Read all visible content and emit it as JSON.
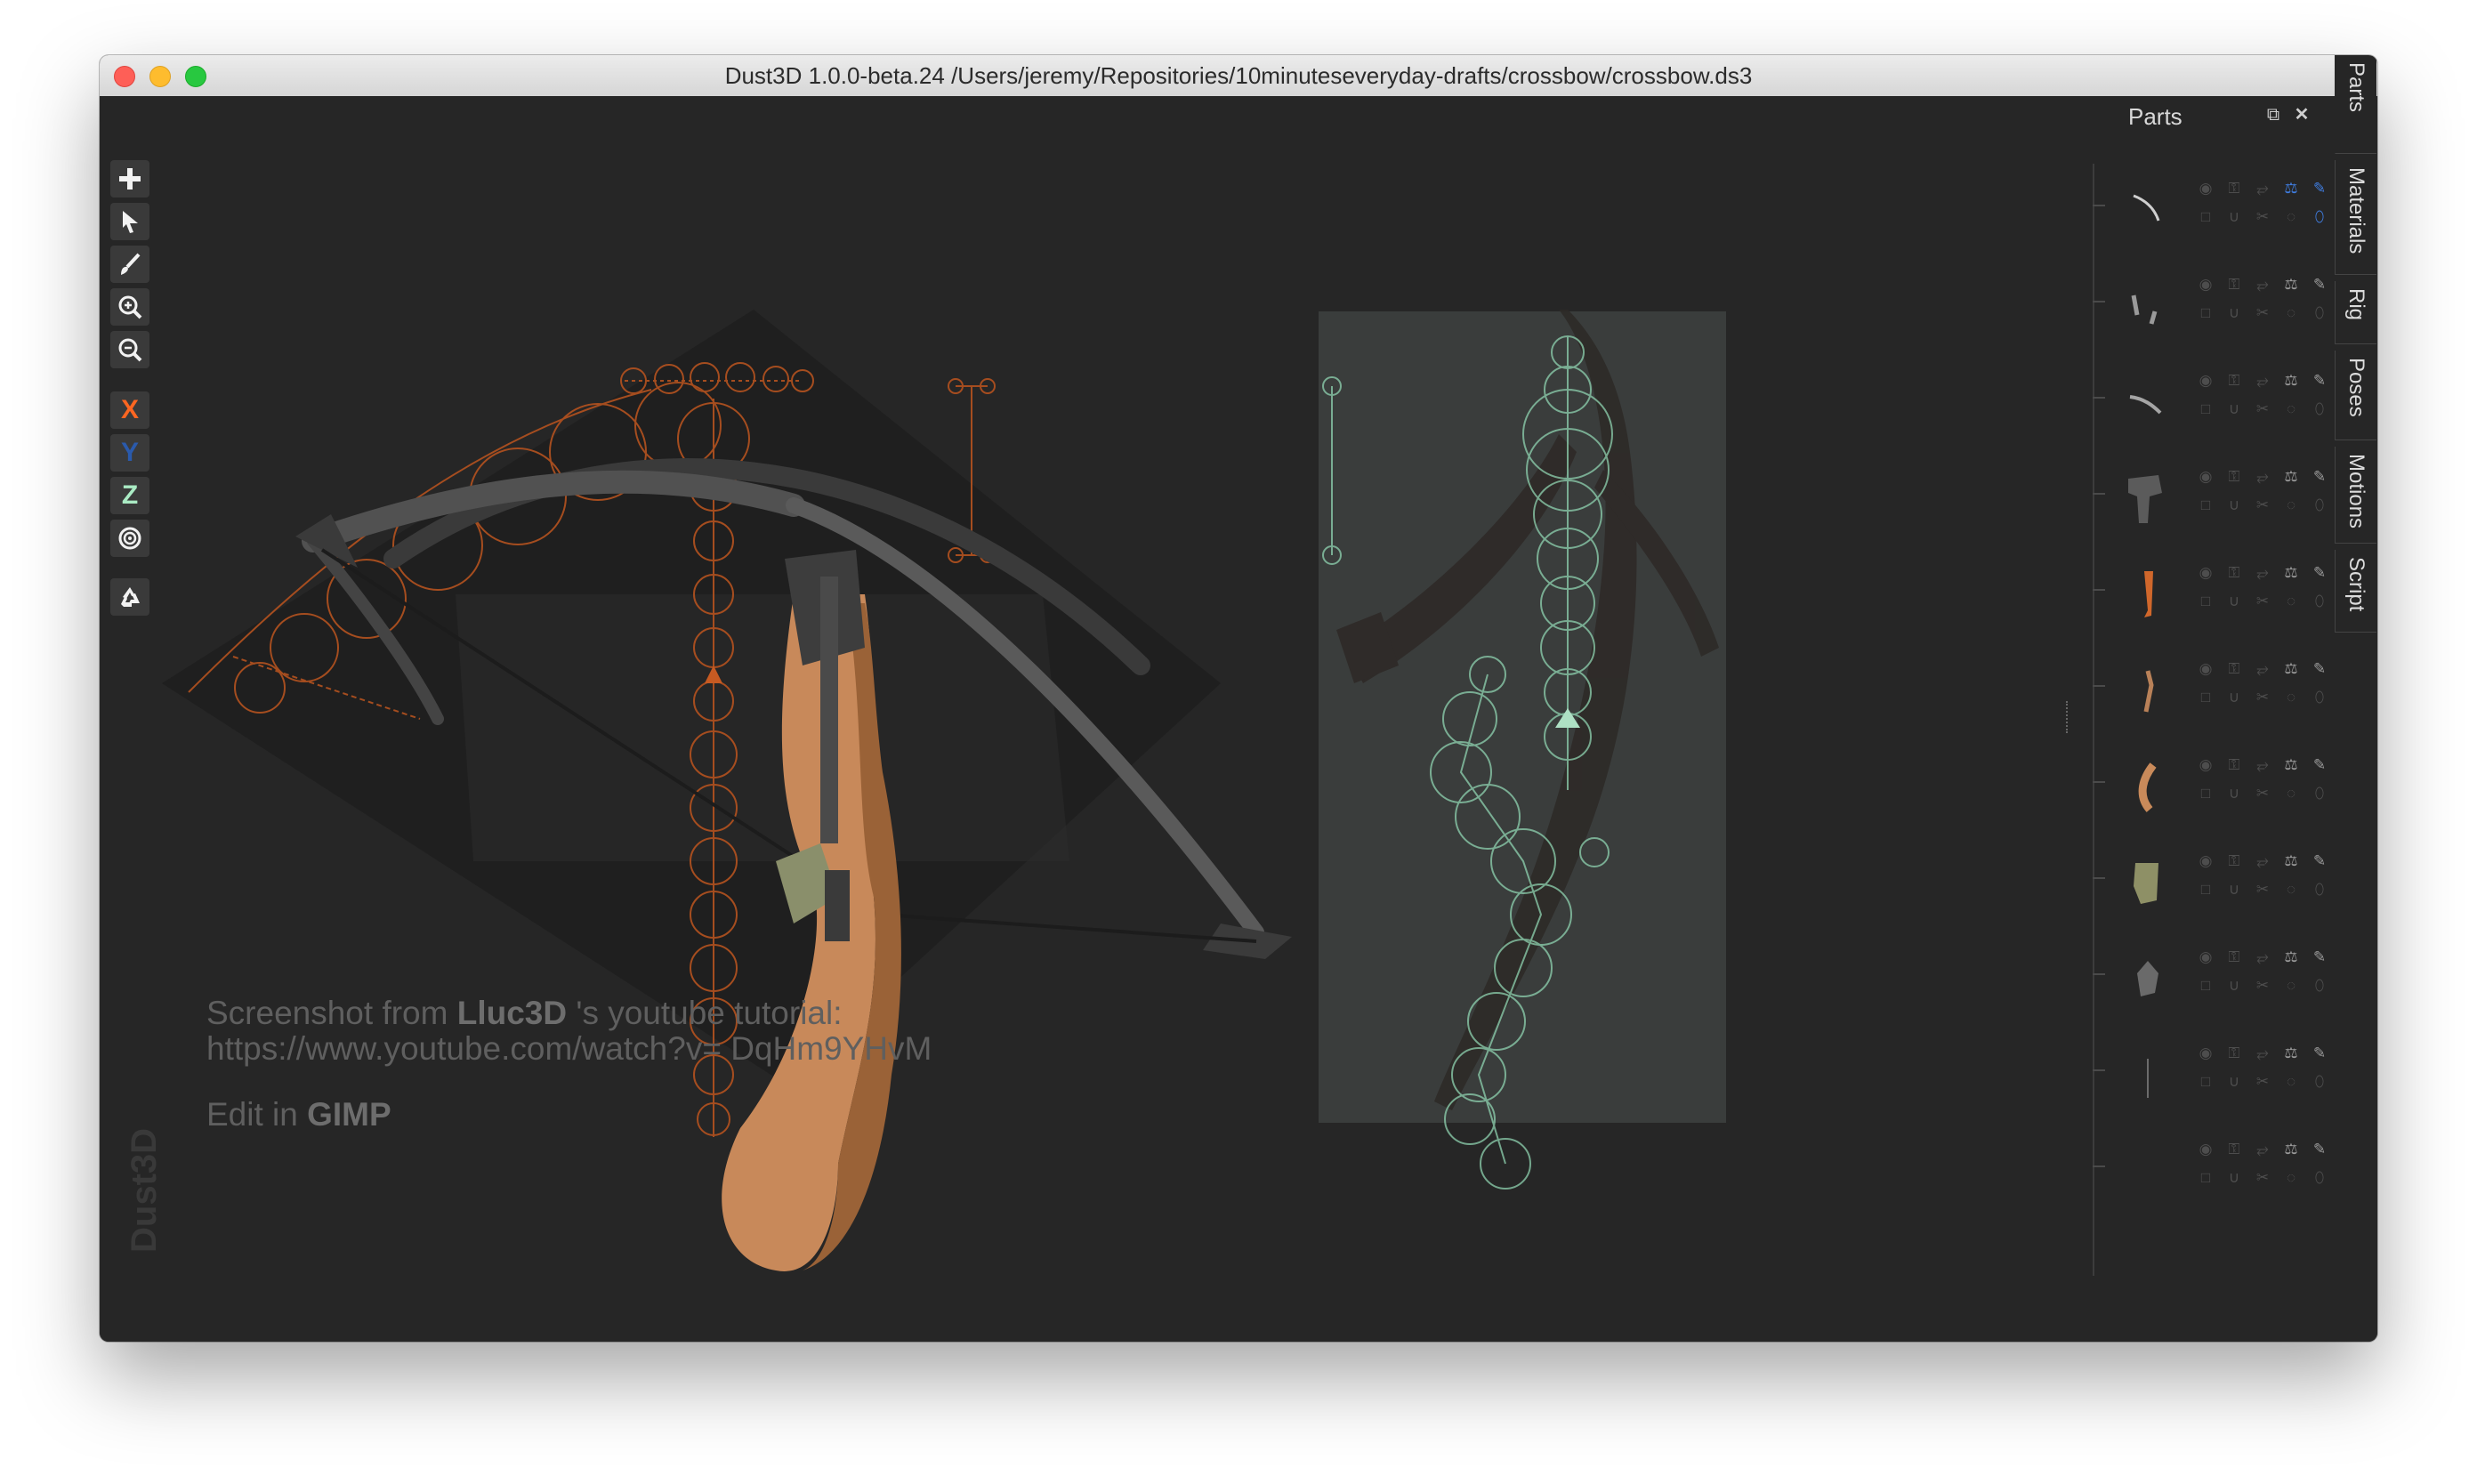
{
  "window": {
    "title": "Dust3D 1.0.0-beta.24 /Users/jeremy/Repositories/10minuteseveryday-drafts/crossbow/crossbow.ds3"
  },
  "toolbar": {
    "tools": [
      {
        "name": "add",
        "icon": "plus-icon"
      },
      {
        "name": "select",
        "icon": "pointer-icon"
      },
      {
        "name": "paint",
        "icon": "brush-icon"
      },
      {
        "name": "zoom-in",
        "icon": "zoom-in-icon"
      },
      {
        "name": "zoom-out",
        "icon": "zoom-out-icon"
      }
    ],
    "axis": {
      "x": "X",
      "y": "Y",
      "z": "Z"
    },
    "axis_colors": {
      "x": "#fc6621",
      "y": "#2a5aac",
      "z": "#aaebc4"
    },
    "extra": [
      {
        "name": "radius",
        "icon": "target-icon"
      },
      {
        "name": "regenerate",
        "icon": "recycle-icon"
      }
    ]
  },
  "overlay": {
    "line1_prefix": "Screenshot from ",
    "line1_bold": "Lluc3D",
    "line1_suffix": " 's youtube tutorial:",
    "line2": "https://www.youtube.com/watch?v=   DqHm9YHvM",
    "line3_prefix": "Edit in ",
    "line3_bold": "GIMP"
  },
  "watermark": "Dust3D",
  "panel": {
    "title": "Parts",
    "restore_icon": "restore-icon",
    "close_icon": "close-icon",
    "parts": [
      {
        "thumb": "bow-limb-thin",
        "highlight": true
      },
      {
        "thumb": "bolts-pair",
        "highlight": false
      },
      {
        "thumb": "bow-limb-curve",
        "highlight": false
      },
      {
        "thumb": "stock-head",
        "highlight": false
      },
      {
        "thumb": "orange-clip",
        "highlight": false
      },
      {
        "thumb": "thin-rod",
        "highlight": false
      },
      {
        "thumb": "curved-grip",
        "highlight": false
      },
      {
        "thumb": "olive-block",
        "highlight": false
      },
      {
        "thumb": "gray-knot",
        "highlight": false
      },
      {
        "thumb": "thin-line",
        "highlight": false
      },
      {
        "thumb": "empty",
        "highlight": false
      }
    ]
  },
  "tabs": [
    "Parts",
    "Materials",
    "Rig",
    "Poses",
    "Motions",
    "Script"
  ],
  "colors": {
    "window_bg": "#262626",
    "accent_orange": "#fc6621",
    "accent_green": "#8fd3b0",
    "highlight_blue": "#3f7de0"
  }
}
